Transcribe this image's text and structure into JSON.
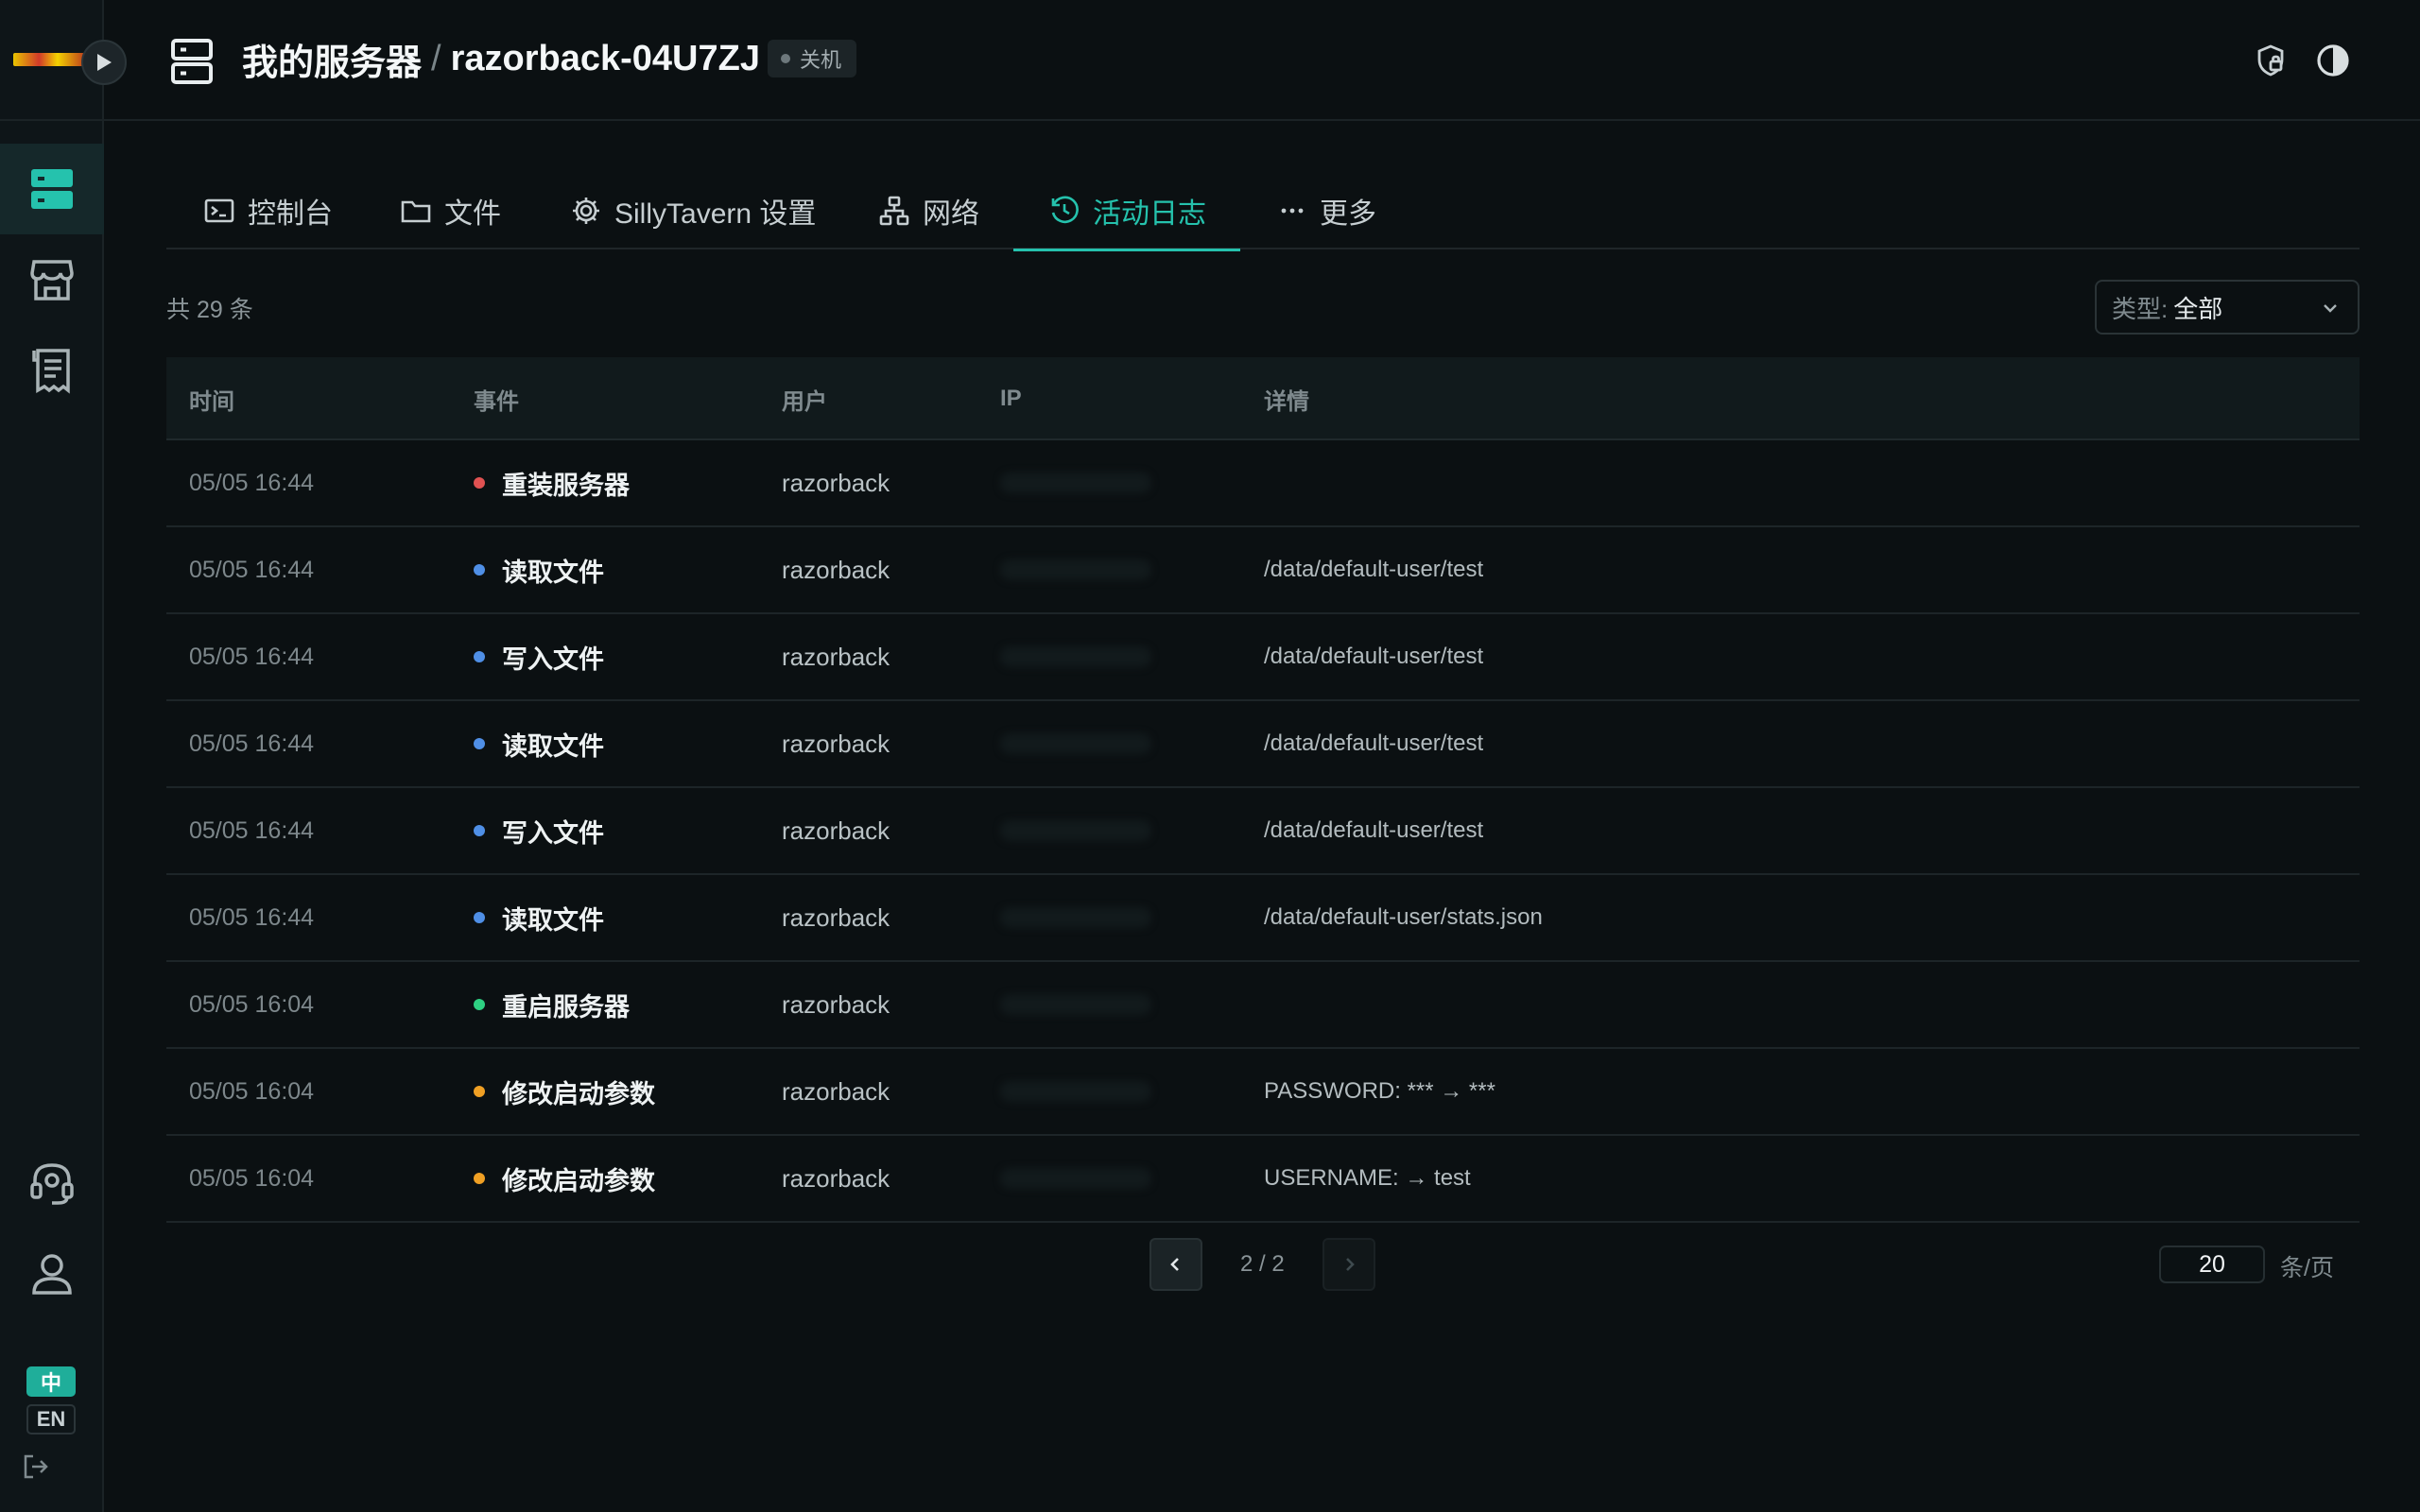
{
  "colors": {
    "accent": "#25c2ad",
    "event_danger": "#e05252",
    "event_info": "#4f8fe6",
    "event_success": "#2ed082",
    "event_warning": "#f0a024"
  },
  "header": {
    "section": "我的服务器",
    "separator": "/",
    "server_name": "razorback-04U7ZJ",
    "status": "关机"
  },
  "tabs": [
    {
      "label": "控制台",
      "icon": "terminal-icon"
    },
    {
      "label": "文件",
      "icon": "folder-icon"
    },
    {
      "label": "SillyTavern 设置",
      "icon": "gear-icon"
    },
    {
      "label": "网络",
      "icon": "network-icon"
    },
    {
      "label": "活动日志",
      "icon": "history-icon",
      "active": true
    },
    {
      "label": "更多",
      "icon": "more-icon"
    }
  ],
  "summary": {
    "total": "共 29 条"
  },
  "filter": {
    "label": "类型:",
    "value": "全部"
  },
  "table": {
    "columns": [
      "时间",
      "事件",
      "用户",
      "IP",
      "详情"
    ],
    "rows": [
      {
        "time": "05/05 16:44",
        "event": "重装服务器",
        "level": "danger",
        "user": "razorback",
        "detail": ""
      },
      {
        "time": "05/05 16:44",
        "event": "读取文件",
        "level": "info",
        "user": "razorback",
        "detail": "/data/default-user/test"
      },
      {
        "time": "05/05 16:44",
        "event": "写入文件",
        "level": "info",
        "user": "razorback",
        "detail": "/data/default-user/test"
      },
      {
        "time": "05/05 16:44",
        "event": "读取文件",
        "level": "info",
        "user": "razorback",
        "detail": "/data/default-user/test"
      },
      {
        "time": "05/05 16:44",
        "event": "写入文件",
        "level": "info",
        "user": "razorback",
        "detail": "/data/default-user/test"
      },
      {
        "time": "05/05 16:44",
        "event": "读取文件",
        "level": "info",
        "user": "razorback",
        "detail": "/data/default-user/stats.json"
      },
      {
        "time": "05/05 16:04",
        "event": "重启服务器",
        "level": "success",
        "user": "razorback",
        "detail": ""
      },
      {
        "time": "05/05 16:04",
        "event": "修改启动参数",
        "level": "warning",
        "user": "razorback",
        "detail": "PASSWORD: *** → ***"
      },
      {
        "time": "05/05 16:04",
        "event": "修改启动参数",
        "level": "warning",
        "user": "razorback",
        "detail": "USERNAME: → test"
      }
    ]
  },
  "pagination": {
    "page_text": "2 / 2",
    "page_size": "20",
    "page_size_unit": "条/页"
  },
  "language": {
    "zh": "中",
    "en": "EN"
  }
}
